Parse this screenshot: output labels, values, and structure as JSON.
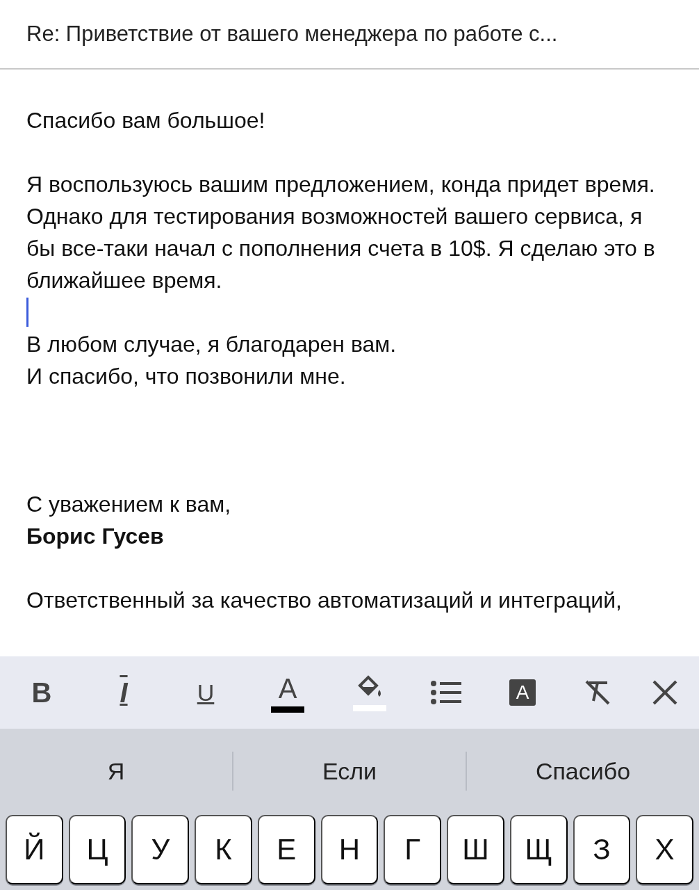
{
  "header": {
    "title": "Re: Приветствие от вашего менеджера по работе с..."
  },
  "body": [
    {
      "kind": "text",
      "text": "Спасибо вам большое!"
    },
    {
      "kind": "blank"
    },
    {
      "kind": "text",
      "text": "Я воспользуюсь вашим предложением, конда придет время. Однако для тестирования возможностей вашего сервиса, я бы все-таки начал с пополнения счета в 10$. Я сделаю это в ближайшее время."
    },
    {
      "kind": "cursor"
    },
    {
      "kind": "text",
      "text": "В любом случае, я благодарен вам."
    },
    {
      "kind": "text",
      "text": "И спасибо, что позвонили мне."
    },
    {
      "kind": "blank"
    },
    {
      "kind": "blank"
    },
    {
      "kind": "blank"
    },
    {
      "kind": "text",
      "text": "С уважением к вам,"
    },
    {
      "kind": "bold",
      "text": "Борис Гусев"
    },
    {
      "kind": "blank"
    },
    {
      "kind": "text",
      "text": "Ответственный за качество автоматизаций и интеграций,"
    }
  ],
  "format_toolbar": [
    {
      "kind": "bold",
      "text": "B"
    },
    {
      "kind": "italic",
      "text": "I"
    },
    {
      "kind": "underline",
      "text": "U"
    },
    {
      "kind": "text-color",
      "text": "A",
      "color": "#000000"
    },
    {
      "kind": "highlight",
      "color": "#ffffff"
    },
    {
      "kind": "list"
    },
    {
      "kind": "style",
      "text": "A"
    },
    {
      "kind": "clear-format"
    },
    {
      "kind": "close"
    }
  ],
  "suggestions": [
    "Я",
    "Если",
    "Спасибо"
  ],
  "keys": [
    "Й",
    "Ц",
    "У",
    "К",
    "Е",
    "Н",
    "Г",
    "Ш",
    "Щ",
    "З",
    "Х"
  ]
}
